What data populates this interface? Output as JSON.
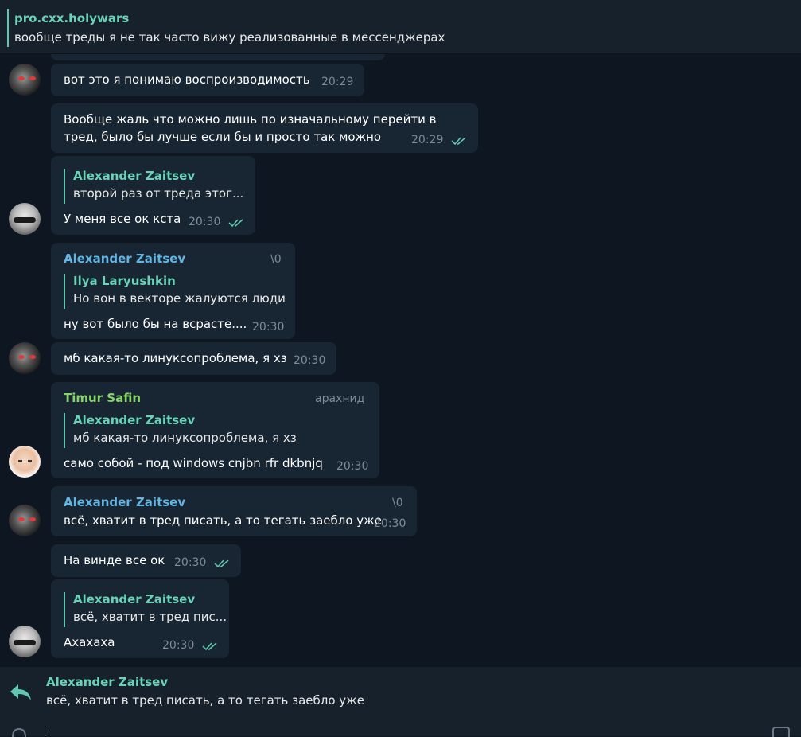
{
  "pinned": {
    "title": "pro.cxx.holywars",
    "text": "вообще треды я не так часто вижу реализованные в мессенджерах"
  },
  "colors": {
    "background": "#0e1621",
    "bubble": "#182533",
    "accent": "#6ad2b7",
    "name_blue": "#64b5e3",
    "name_green": "#86d46a"
  },
  "messages": [
    {
      "text": "вот это я понимаю воспроизводимость",
      "time": "20:29"
    },
    {
      "text_line1": "Вообще жаль что можно лишь по изначальному перейти в",
      "text_line2": "тред, было бы лучше если бы и просто так можно",
      "time": "20:29"
    },
    {
      "quote_name": "Alexander Zaitsev",
      "quote_text": "второй раз от треда этог...",
      "text": "У меня все ок кста",
      "time": "20:30"
    },
    {
      "sender": "Alexander Zaitsev",
      "rank": "\\0",
      "quote_name": "Ilya Laryushkin",
      "quote_text": "Но вон в векторе жалуются люди",
      "text": "ну вот было бы на всрасте....",
      "time": "20:30"
    },
    {
      "text": "мб какая-то линуксопроблема, я хз",
      "time": "20:30"
    },
    {
      "sender": "Timur Safin",
      "rank": "арахнид",
      "quote_name": "Alexander Zaitsev",
      "quote_text": "мб какая-то линуксопроблема, я хз",
      "text": "само собой - под windows cnjbn rfr dkbnjq",
      "time": "20:30"
    },
    {
      "sender": "Alexander Zaitsev",
      "rank": "\\0",
      "text": "всё, хватит в тред писать, а то тегать заебло уже",
      "time": "20:30"
    },
    {
      "text": "На винде все ок",
      "time": "20:30"
    },
    {
      "quote_name": "Alexander Zaitsev",
      "quote_text": "всё, хватит в тред пис...",
      "text": "Ахахаха",
      "time": "20:30"
    }
  ],
  "reply": {
    "name": "Alexander Zaitsev",
    "text": "всё, хватит в тред писать, а то тегать заебло уже"
  }
}
